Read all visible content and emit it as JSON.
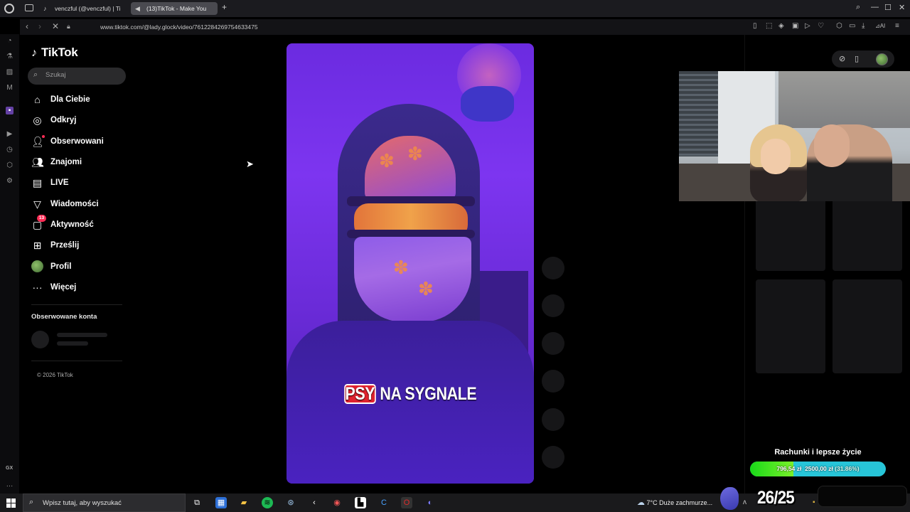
{
  "browser": {
    "tabs": [
      {
        "label": "venczful (@venczful) | Ti",
        "icon": "tiktok-icon"
      },
      {
        "label": "(13)TikTok - Make You",
        "icon": "speaker-icon",
        "active": true
      }
    ],
    "url": "www.tiktok.com/@lady.glock/video/7612284269754633475",
    "sidebar_label": "GX"
  },
  "tiktok": {
    "logo": "TikTok",
    "search_placeholder": "Szukaj",
    "nav": [
      {
        "label": "Dla Ciebie",
        "icon": "home-icon"
      },
      {
        "label": "Odkryj",
        "icon": "compass-icon"
      },
      {
        "label": "Obserwowani",
        "icon": "following-icon"
      },
      {
        "label": "Znajomi",
        "icon": "friends-icon"
      },
      {
        "label": "LIVE",
        "icon": "live-icon"
      },
      {
        "label": "Wiadomości",
        "icon": "messages-icon"
      },
      {
        "label": "Aktywność",
        "icon": "activity-icon",
        "badge": "13"
      },
      {
        "label": "Prześlij",
        "icon": "upload-icon"
      },
      {
        "label": "Profil",
        "icon": "profile-avatar"
      },
      {
        "label": "Więcej",
        "icon": "more-icon"
      }
    ],
    "following_title": "Obserwowane konta",
    "copyright": "© 2026 TikTok"
  },
  "video": {
    "caption_highlight": "PSY",
    "caption_rest": " NA SYGNALE"
  },
  "stream_overlay": {
    "goal_title": "Rachunki i lepsze życie",
    "goal_current": "796,54 zł",
    "goal_target": "2500,00 zł",
    "goal_percent_text": "(31.86%)",
    "goal_progress": 0.3186,
    "counter": "26/25"
  },
  "taskbar": {
    "search_placeholder": "Wpisz tutaj, aby wyszukać",
    "weather": "7°C  Duże zachmurze..."
  },
  "colors": {
    "accent": "#fe2c55",
    "goal_fill": "#19d919",
    "goal_bg": "#27c5d8"
  }
}
